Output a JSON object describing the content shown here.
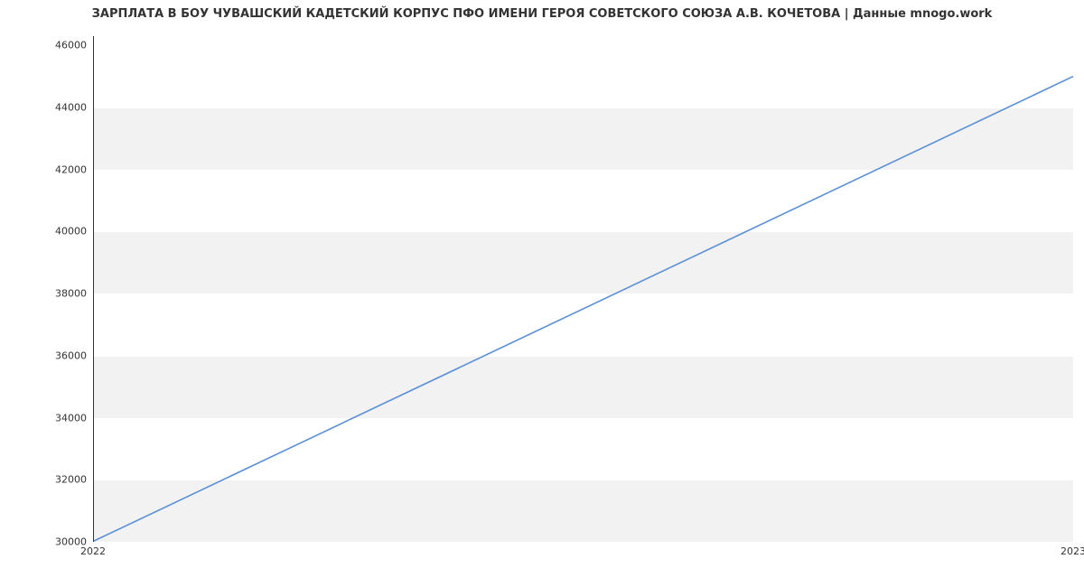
{
  "chart_data": {
    "type": "line",
    "title": "ЗАРПЛАТА В БОУ ЧУВАШСКИЙ КАДЕТСКИЙ КОРПУС ПФО ИМЕНИ ГЕРОЯ СОВЕТСКОГО СОЮЗА А.В. КОЧЕТОВА | Данные mnogo.work",
    "x": [
      2022,
      2023
    ],
    "values": [
      30000,
      45000
    ],
    "xticks": [
      "2022",
      "2023"
    ],
    "yticks": [
      30000,
      32000,
      34000,
      36000,
      38000,
      40000,
      42000,
      44000,
      46000
    ],
    "xlim": [
      2022,
      2023
    ],
    "ylim": [
      30000,
      46300
    ],
    "xlabel": "",
    "ylabel": "",
    "line_color": "#5b8fd6"
  }
}
